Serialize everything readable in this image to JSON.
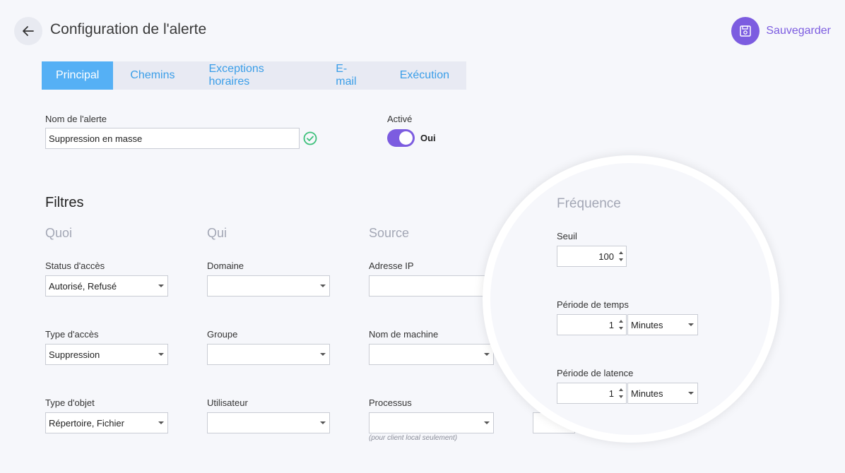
{
  "header": {
    "title": "Configuration de l'alerte",
    "save_label": "Sauvegarder"
  },
  "tabs": [
    {
      "label": "Principal",
      "active": true
    },
    {
      "label": "Chemins",
      "active": false
    },
    {
      "label": "Exceptions horaires",
      "active": false
    },
    {
      "label": "E-mail",
      "active": false
    },
    {
      "label": "Exécution",
      "active": false
    }
  ],
  "alert_name": {
    "label": "Nom de l'alerte",
    "value": "Suppression en masse"
  },
  "enabled": {
    "label": "Activé",
    "state_text": "Oui",
    "on": true
  },
  "filters": {
    "title": "Filtres",
    "columns": {
      "quoi": "Quoi",
      "qui": "Qui",
      "source": "Source"
    },
    "status_acces": {
      "label": "Status d'accès",
      "value": "Autorisé, Refusé"
    },
    "type_acces": {
      "label": "Type d'accès",
      "value": "Suppression"
    },
    "type_objet": {
      "label": "Type d'objet",
      "value": "Répertoire, Fichier"
    },
    "domaine": {
      "label": "Domaine",
      "value": ""
    },
    "groupe": {
      "label": "Groupe",
      "value": ""
    },
    "utilisateur": {
      "label": "Utilisateur",
      "value": ""
    },
    "adresse_ip": {
      "label": "Adresse IP",
      "value": ""
    },
    "nom_machine": {
      "label": "Nom de machine",
      "value": ""
    },
    "processus": {
      "label": "Processus",
      "value": "",
      "hint": "(pour client local seulement)"
    }
  },
  "frequence": {
    "title": "Fréquence",
    "seuil": {
      "label": "Seuil",
      "value": "100"
    },
    "periode_temps": {
      "label": "Période de temps",
      "value": "1",
      "unit": "Minutes"
    },
    "periode_latence": {
      "label": "Période de latence",
      "value": "1",
      "unit": "Minutes"
    }
  },
  "colors": {
    "accent": "#7c5ce0",
    "tab_active": "#55b0f5",
    "tab_text": "#3b9ee8",
    "success": "#3cc07a"
  }
}
